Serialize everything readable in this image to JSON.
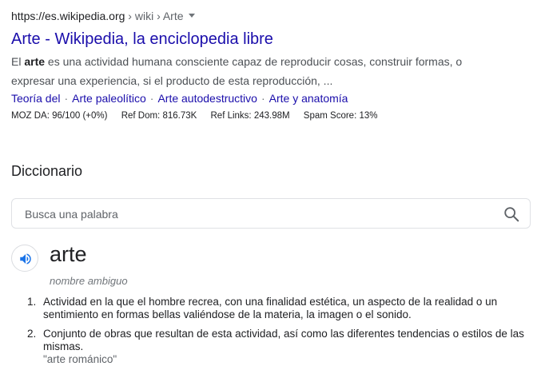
{
  "result": {
    "url": "https://es.wikipedia.org",
    "breadcrumb": " › wiki › Arte",
    "title": "Arte - Wikipedia, la enciclopedia libre",
    "snippet_prefix": "El ",
    "snippet_bold": "arte",
    "snippet_rest": " es una actividad humana consciente capaz de reproducir cosas, construir formas, o expresar una experiencia, si el producto de esta reproducción, ...",
    "sitelinks": [
      "Teoría del",
      "Arte paleolítico",
      "Arte autodestructivo",
      "Arte y anatomía"
    ],
    "sitelink_separator": "·"
  },
  "moz": {
    "da": "MOZ DA: 96/100 (+0%)",
    "ref_dom": "Ref Dom: 816.73K",
    "ref_links": "Ref Links: 243.98M",
    "spam": "Spam Score: 13%"
  },
  "dictionary": {
    "header": "Diccionario",
    "search_placeholder": "Busca una palabra",
    "word": "arte",
    "part_of_speech": "nombre ambiguo",
    "definitions": [
      {
        "num": "1.",
        "text": "Actividad en la que el hombre recrea, con una finalidad estética, un aspecto de la realidad o un sentimiento en formas bellas valiéndose de la materia, la imagen o el sonido.",
        "example": ""
      },
      {
        "num": "2.",
        "text": "Conjunto de obras que resultan de esta actividad, así como las diferentes tendencias o estilos de las mismas.",
        "example": "\"arte románico\""
      }
    ]
  },
  "icons": {
    "search": "search-icon",
    "speaker": "speaker-icon",
    "caret": "caret-down-icon"
  },
  "colors": {
    "link": "#1a0dab",
    "speaker_blue": "#1a73e8"
  }
}
